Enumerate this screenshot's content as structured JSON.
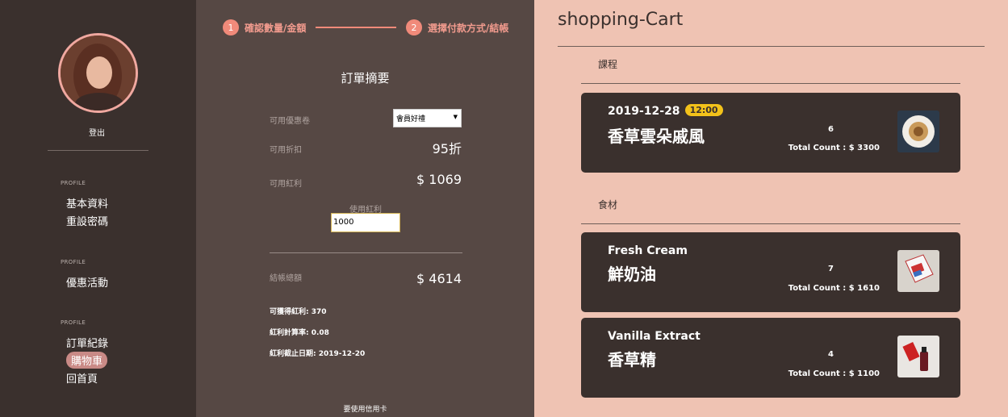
{
  "sidebar": {
    "logout": "登出",
    "sections": [
      {
        "label": "PROFILE",
        "items": [
          "基本資料",
          "重設密碼"
        ]
      },
      {
        "label": "PROFILE",
        "items": [
          "優惠活動"
        ]
      },
      {
        "label": "PROFILE",
        "items": [
          "訂單紀錄",
          "購物車",
          "回首頁"
        ]
      }
    ],
    "active_item": "購物車"
  },
  "steps": [
    {
      "num": "1",
      "label": "確認數量/金額"
    },
    {
      "num": "2",
      "label": "選擇付款方式/結帳"
    }
  ],
  "summary": {
    "title": "訂單摘要",
    "coupon_label": "可用優惠卷",
    "coupon_selected": "會員好禮",
    "discount_label": "可用折扣",
    "discount_value": "95折",
    "bonus_label": "可用紅利",
    "bonus_value": "$ 1069",
    "use_bonus_label": "使用紅利",
    "use_bonus_value": "1000",
    "total_label": "結帳總額",
    "total_value": "$ 4614",
    "earn_bonus": "可獲得紅利: 370",
    "bonus_rate": "紅利計算率: 0.08",
    "bonus_expiry": "紅利截止日期: 2019-12-20",
    "bottom_text": "要使用信用卡"
  },
  "cart": {
    "title": "shopping-Cart",
    "course_label": "課程",
    "ingredient_label": "食材",
    "courses": [
      {
        "date": "2019-12-28",
        "time": "12:00",
        "name": "香草雲朵戚風",
        "qty": "6",
        "total": "Total Count : $ 3300"
      }
    ],
    "ingredients": [
      {
        "name_en": "Fresh Cream",
        "name_zh": "鮮奶油",
        "qty": "7",
        "total": "Total Count : $ 1610"
      },
      {
        "name_en": "Vanilla Extract",
        "name_zh": "香草精",
        "qty": "4",
        "total": "Total Count : $ 1100"
      }
    ]
  },
  "colors": {
    "sidebar_bg": "#3a302d",
    "middle_bg": "#564844",
    "right_bg": "#efc3b3",
    "accent": "#f08a7a",
    "badge": "#f3c21a"
  }
}
